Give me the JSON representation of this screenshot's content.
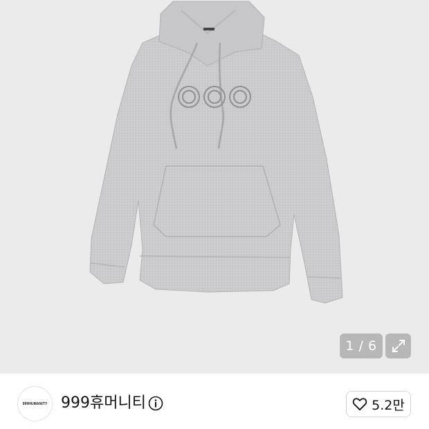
{
  "gallery": {
    "current_page": "1",
    "total_pages": "6",
    "pager_text": "1 / 6",
    "expand_icon": "expand-arrows-icon",
    "product_image": "gray-hoodie-with-three-circle-embroidery"
  },
  "brand": {
    "logo_text": "999HUMANITY",
    "name": "999휴머니티",
    "info_icon": "info-icon"
  },
  "like": {
    "icon": "heart-outline-icon",
    "count": "5.2만"
  },
  "colors": {
    "background": "#ecebec",
    "hoodie": "#c9c9cb",
    "overlay": "#8c8c8c"
  }
}
